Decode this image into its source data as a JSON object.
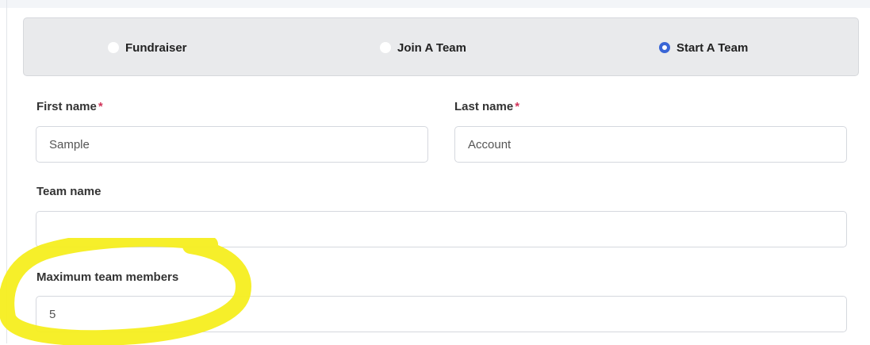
{
  "registration_type": {
    "options": [
      {
        "label": "Fundraiser",
        "selected": false
      },
      {
        "label": "Join A Team",
        "selected": false
      },
      {
        "label": "Start A Team",
        "selected": true
      }
    ]
  },
  "form": {
    "first_name": {
      "label": "First name",
      "required_mark": "*",
      "value": "Sample"
    },
    "last_name": {
      "label": "Last name",
      "required_mark": "*",
      "value": "Account"
    },
    "team_name": {
      "label": "Team name",
      "value": ""
    },
    "max_team_members": {
      "label": "Maximum team members",
      "value": "5"
    }
  },
  "colors": {
    "accent": "#3a66d6",
    "required": "#d1355a",
    "highlight": "#f5ee1f"
  }
}
